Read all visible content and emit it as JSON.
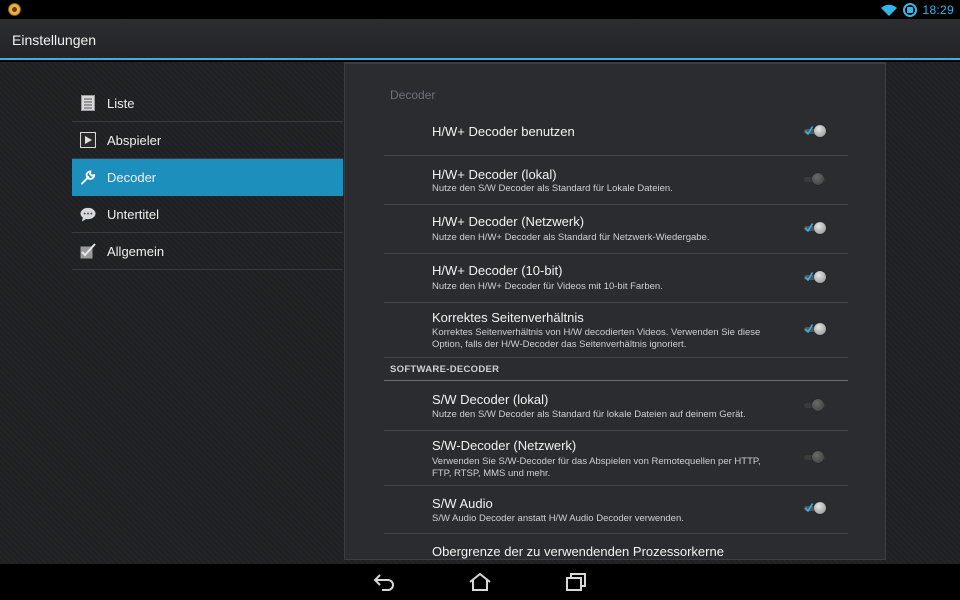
{
  "statusbar": {
    "time": "18:29"
  },
  "actionbar": {
    "title": "Einstellungen"
  },
  "menu": {
    "items": [
      {
        "label": "Liste",
        "icon": "list-icon",
        "active": false
      },
      {
        "label": "Abspieler",
        "icon": "play-icon",
        "active": false
      },
      {
        "label": "Decoder",
        "icon": "wrench-icon",
        "active": true
      },
      {
        "label": "Untertitel",
        "icon": "speech-bubble-icon",
        "active": false
      },
      {
        "label": "Allgemein",
        "icon": "check-edit-icon",
        "active": false
      }
    ]
  },
  "panel": {
    "header": "Decoder",
    "prefs": [
      {
        "title": "H/W+ Decoder benutzen",
        "summary": "",
        "checked": true
      },
      {
        "title": "H/W+ Decoder (lokal)",
        "summary": "Nutze den S/W Decoder als Standard für Lokale Dateien.",
        "checked": false
      },
      {
        "title": "H/W+ Decoder (Netzwerk)",
        "summary": "Nutze den H/W+ Decoder als Standard für Netzwerk-Wiedergabe.",
        "checked": true
      },
      {
        "title": "H/W+ Decoder (10-bit)",
        "summary": "Nutze den H/W+ Decoder für Videos mit 10-bit Farben.",
        "checked": true
      },
      {
        "title": "Korrektes Seitenverhältnis",
        "summary": "Korrektes Seitenverhältnis von H/W decodierten Videos. Verwenden Sie diese Option, falls der H/W-Decoder das Seitenverhältnis ignoriert.",
        "checked": true
      }
    ],
    "category": "SOFTWARE-DECODER",
    "software_prefs": [
      {
        "title": "S/W Decoder (lokal)",
        "summary": "Nutze den S/W Decoder als Standard für lokale Dateien auf deinem Gerät.",
        "checked": false
      },
      {
        "title": "S/W-Decoder (Netzwerk)",
        "summary": "Verwenden Sie S/W-Decoder für das Abspielen von Remotequellen per HTTP, FTP, RTSP, MMS und mehr.",
        "checked": false
      },
      {
        "title": "S/W Audio",
        "summary": "S/W Audio Decoder anstatt H/W Audio Decoder verwenden.",
        "checked": true
      },
      {
        "title": "Obergrenze der zu verwendenden Prozessorkerne",
        "summary": "",
        "checked": null
      }
    ]
  },
  "navbar": {
    "icons": [
      "back-icon",
      "home-icon",
      "recent-apps-icon"
    ]
  },
  "colors": {
    "accent": "#33b5e5",
    "active_item": "#1d8fbd"
  }
}
